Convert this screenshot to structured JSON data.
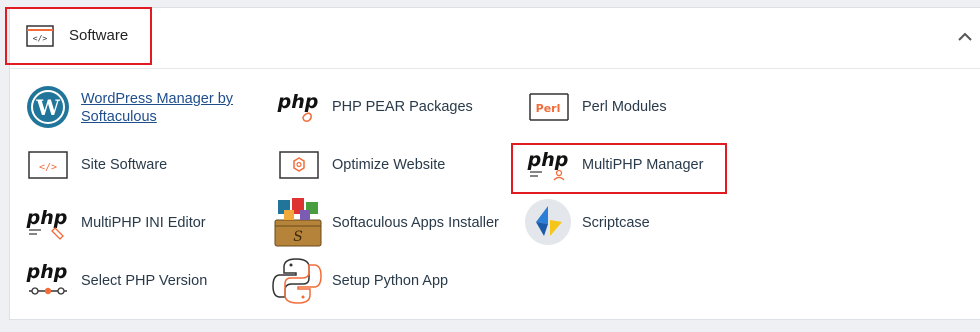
{
  "section": {
    "title": "Software",
    "collapse_icon": "chevron-up-icon"
  },
  "items": [
    {
      "id": "wordpress-manager",
      "label": "WordPress Manager by Softaculous",
      "icon": "wordpress-icon"
    },
    {
      "id": "php-pear",
      "label": "PHP PEAR Packages",
      "icon": "php-pear-icon"
    },
    {
      "id": "perl-modules",
      "label": "Perl Modules",
      "icon": "perl-icon",
      "icon_text": "Perl"
    },
    {
      "id": "site-software",
      "label": "Site Software",
      "icon": "code-window-icon"
    },
    {
      "id": "optimize-website",
      "label": "Optimize Website",
      "icon": "optimize-icon"
    },
    {
      "id": "multiphp-manager",
      "label": "MultiPHP Manager",
      "icon": "php-manager-icon"
    },
    {
      "id": "multiphp-ini",
      "label": "MultiPHP INI Editor",
      "icon": "php-ini-icon"
    },
    {
      "id": "softaculous",
      "label": "Softaculous Apps Installer",
      "icon": "softaculous-icon"
    },
    {
      "id": "scriptcase",
      "label": "Scriptcase",
      "icon": "scriptcase-icon"
    },
    {
      "id": "select-php",
      "label": "Select PHP Version",
      "icon": "php-version-icon"
    },
    {
      "id": "python-app",
      "label": "Setup Python App",
      "icon": "python-icon"
    }
  ],
  "php_glyph": "php",
  "colors": {
    "accent_orange": "#f26c3a",
    "highlight_red": "#e21b23",
    "label_text": "#293a4a",
    "link_blue": "#1f4e8c",
    "wordpress_blue": "#21759b"
  }
}
